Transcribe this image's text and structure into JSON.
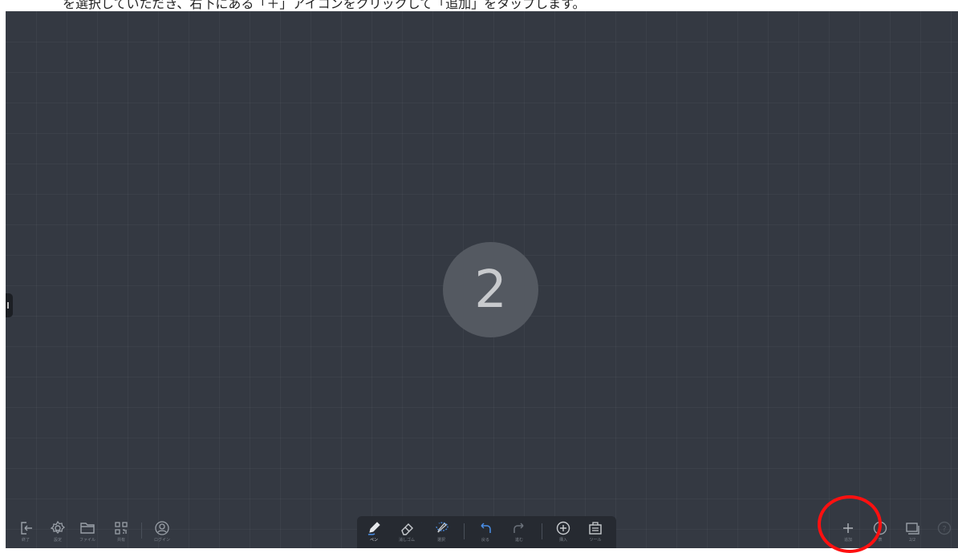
{
  "caption": "を選択していただき、右下にある「＋」アイコンをクリックして「追加」をタップします。",
  "page_indicator": "2",
  "left_toolbar": [
    {
      "label": "終了",
      "icon": "exit-icon"
    },
    {
      "label": "設定",
      "icon": "gear-icon"
    },
    {
      "label": "ファイル",
      "icon": "folder-icon"
    },
    {
      "label": "共有",
      "icon": "qr-code-icon"
    },
    {
      "label": "ログイン",
      "icon": "user-icon"
    }
  ],
  "center_toolbar": [
    {
      "label": "ペン",
      "icon": "pen-icon"
    },
    {
      "label": "消しゴム",
      "icon": "eraser-icon"
    },
    {
      "label": "選択",
      "icon": "lasso-select-icon"
    },
    {
      "label": "戻る",
      "icon": "undo-icon"
    },
    {
      "label": "進む",
      "icon": "redo-icon"
    },
    {
      "label": "挿入",
      "icon": "insert-icon"
    },
    {
      "label": "ツール",
      "icon": "toolbox-icon"
    }
  ],
  "right_toolbar": [
    {
      "label": "追加",
      "icon": "plus-icon"
    },
    {
      "label": "表",
      "icon": "circle-icon"
    },
    {
      "label": "2/2",
      "icon": "pages-icon"
    },
    {
      "label": "?",
      "icon": "help-icon"
    }
  ],
  "colors": {
    "board": "#343942",
    "toolbar": "#262a31",
    "icon": "#9aa0a8",
    "highlight": "#ff1010",
    "pen_accent": "#4a8fe8"
  }
}
